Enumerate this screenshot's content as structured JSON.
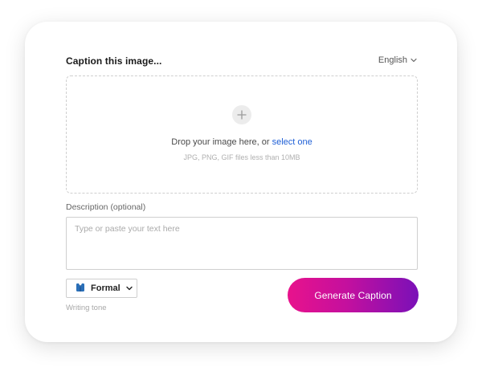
{
  "header": {
    "title": "Caption this image...",
    "language": "English"
  },
  "upload": {
    "prompt": "Drop your image here, or ",
    "link": "select one",
    "hint": "JPG, PNG, GIF files less than 10MB"
  },
  "description": {
    "label": "Description (optional)",
    "placeholder": "Type or paste your text here",
    "value": ""
  },
  "tone": {
    "selected": "Formal",
    "label": "Writing tone",
    "icon": "business-suit-icon"
  },
  "actions": {
    "generate_label": "Generate Caption"
  },
  "colors": {
    "accent_link": "#1e5fd6",
    "button_gradient_start": "#e8128c",
    "button_gradient_end": "#7a10b8"
  }
}
